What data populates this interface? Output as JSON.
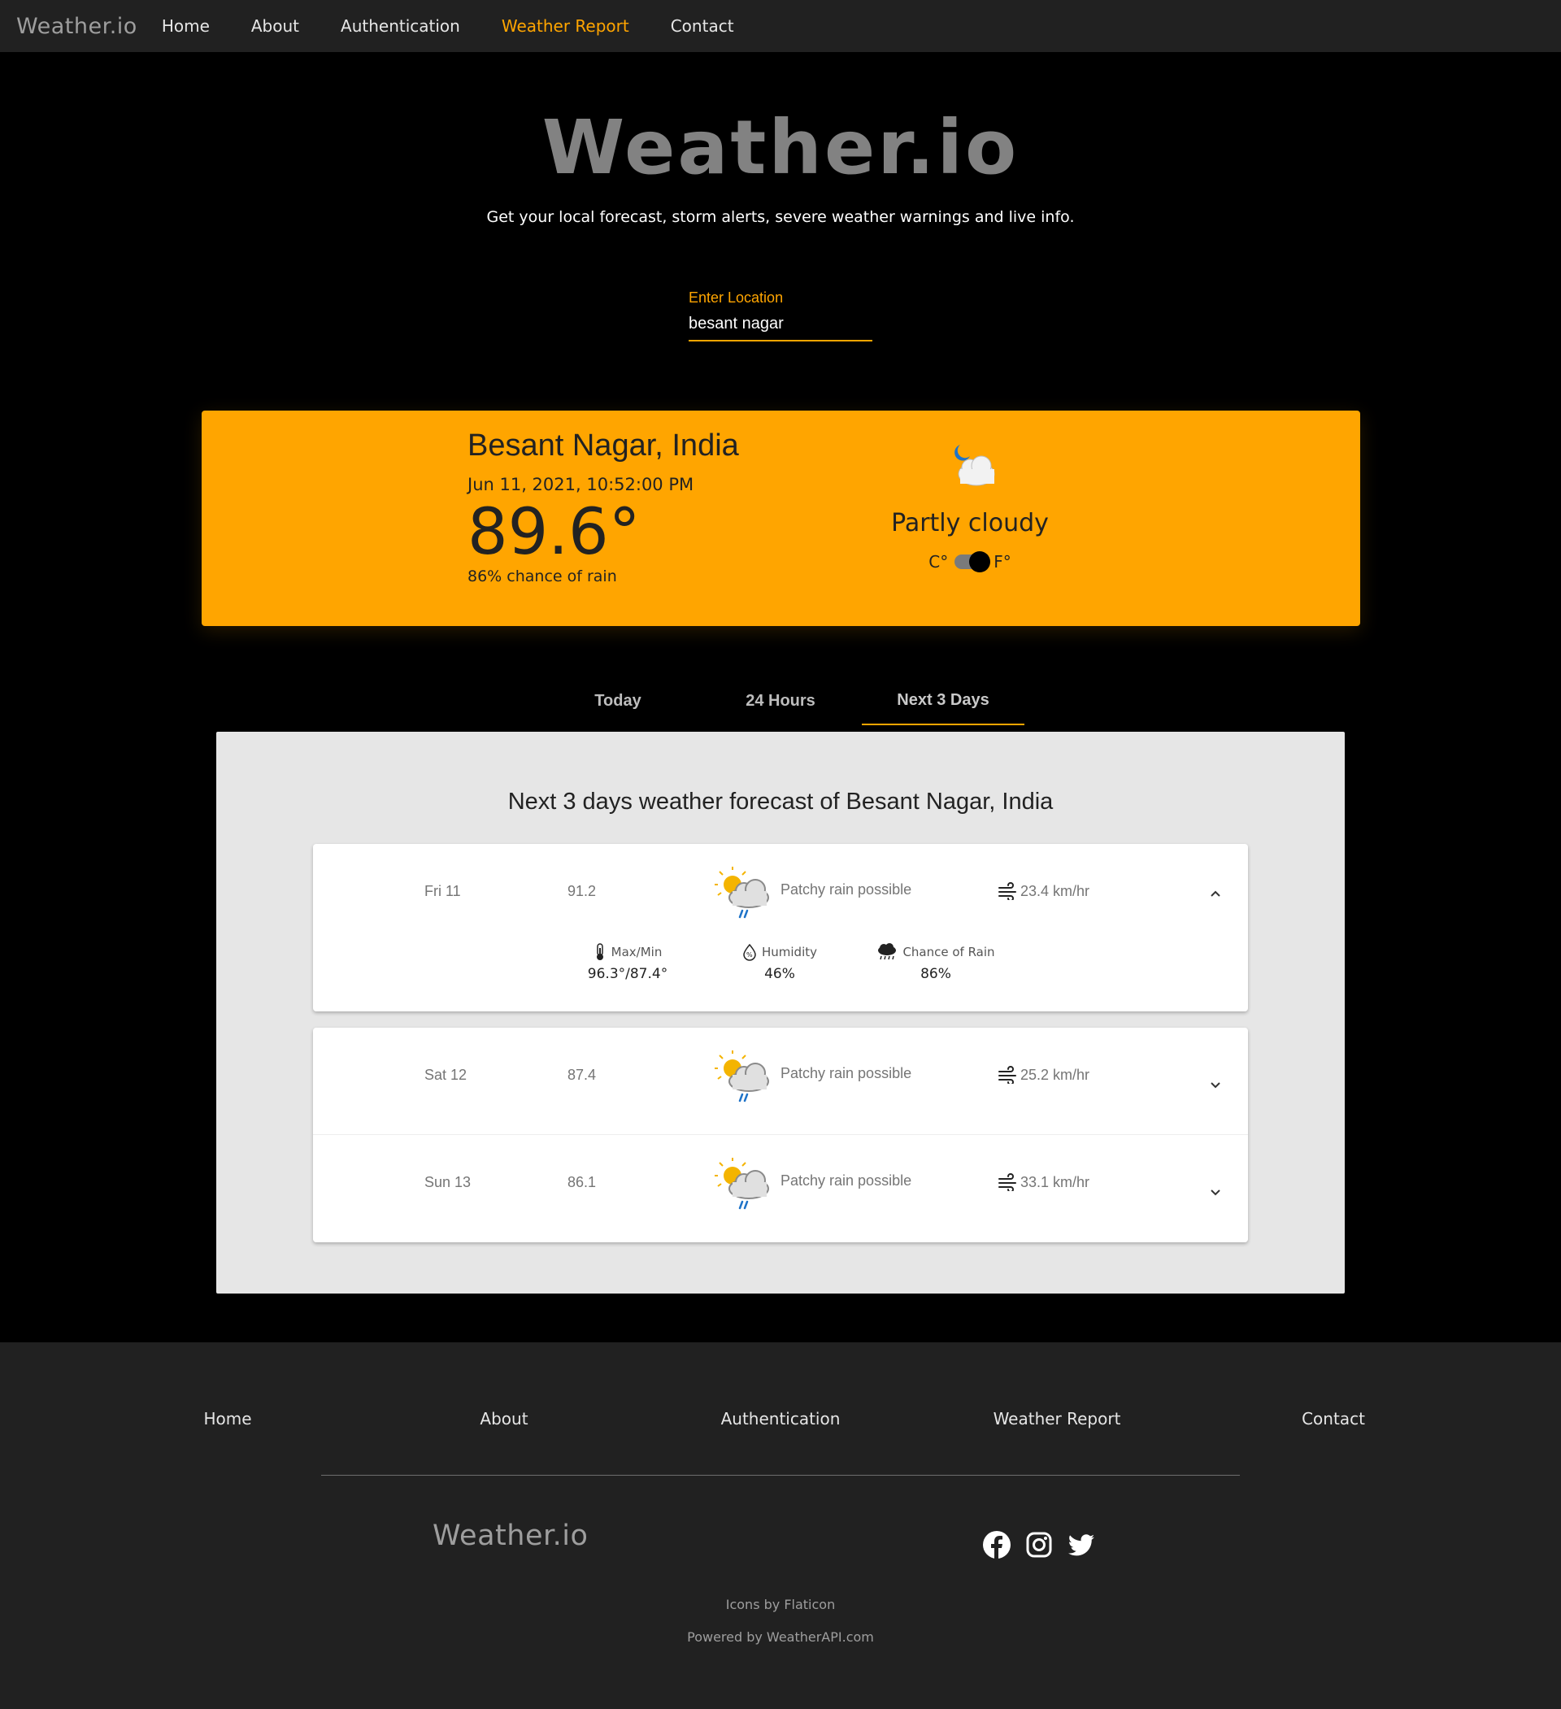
{
  "navbar": {
    "logo": "Weather.io",
    "links": [
      "Home",
      "About",
      "Authentication",
      "Weather Report",
      "Contact"
    ],
    "active": "Weather Report"
  },
  "hero": {
    "title": "Weather.io",
    "subtitle": "Get your local forecast, storm alerts, severe weather warnings and live info."
  },
  "search": {
    "label": "Enter Location",
    "value": "besant nagar"
  },
  "current": {
    "location": "Besant Nagar, India",
    "datetime": "Jun 11, 2021, 10:52:00 PM",
    "temperature": "89.6°",
    "rain_chance": "86% chance of rain",
    "condition": "Partly cloudy",
    "unit_c": "C°",
    "unit_f": "F°",
    "unit_selected": "F",
    "condition_icon": "moon-cloud-icon"
  },
  "tabs": [
    "Today",
    "24 Hours",
    "Next 3 Days"
  ],
  "active_tab": "Next 3 Days",
  "forecast": {
    "title": "Next 3 days weather forecast of Besant Nagar, India",
    "days": [
      {
        "day": "Fri 11",
        "temp": "91.2",
        "condition": "Patchy rain possible",
        "wind": "23.4 km/hr",
        "expanded": true,
        "details": {
          "maxmin_label": "Max/Min",
          "maxmin_value": "96.3°/87.4°",
          "humidity_label": "Humidity",
          "humidity_value": "46%",
          "rain_label": "Chance of Rain",
          "rain_value": "86%"
        }
      },
      {
        "day": "Sat 12",
        "temp": "87.4",
        "condition": "Patchy rain possible",
        "wind": "25.2 km/hr",
        "expanded": false
      },
      {
        "day": "Sun 13",
        "temp": "86.1",
        "condition": "Patchy rain possible",
        "wind": "33.1 km/hr",
        "expanded": false
      }
    ]
  },
  "footer": {
    "links": [
      "Home",
      "About",
      "Authentication",
      "Weather Report",
      "Contact"
    ],
    "logo": "Weather.io",
    "social": [
      "facebook-icon",
      "instagram-icon",
      "twitter-icon"
    ],
    "credit_icons": "Icons by Flaticon",
    "credit_api": "Powered by WeatherAPI.com"
  },
  "colors": {
    "accent": "#ffa500",
    "nav_bg": "#212121",
    "page_bg": "#000000",
    "panel_bg": "#e6e6e6"
  }
}
